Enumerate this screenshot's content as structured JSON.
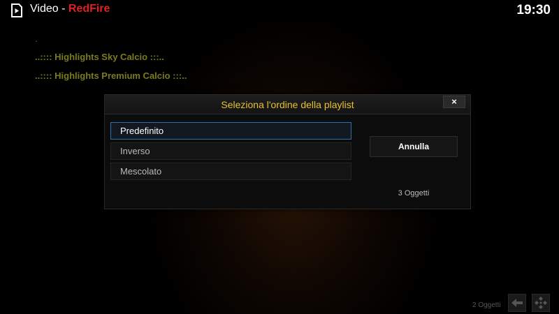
{
  "header": {
    "section": "Video",
    "separator": " - ",
    "addon_name": "RedFire",
    "clock": "19:30",
    "icon": "video-play-icon"
  },
  "background_list": {
    "marker": ".",
    "items": [
      "..:::: Highlights Sky Calcio :::..",
      "..:::: Highlights Premium Calcio :::.."
    ]
  },
  "dialog": {
    "title": "Seleziona l'ordine della playlist",
    "close_label": "×",
    "options": [
      {
        "label": "Predefinito",
        "selected": true
      },
      {
        "label": "Inverso",
        "selected": false
      },
      {
        "label": "Mescolato",
        "selected": false
      }
    ],
    "cancel_label": "Annulla",
    "item_count": "3 Oggetti"
  },
  "footer": {
    "item_count": "2 Oggetti",
    "back_icon": "back-arrow-icon",
    "home_icon": "kodi-logo-icon"
  },
  "colors": {
    "accent_title": "#e8c030",
    "brand_red": "#e02020",
    "selection_border": "#2f6fae",
    "list_text": "#7d7a1e"
  }
}
